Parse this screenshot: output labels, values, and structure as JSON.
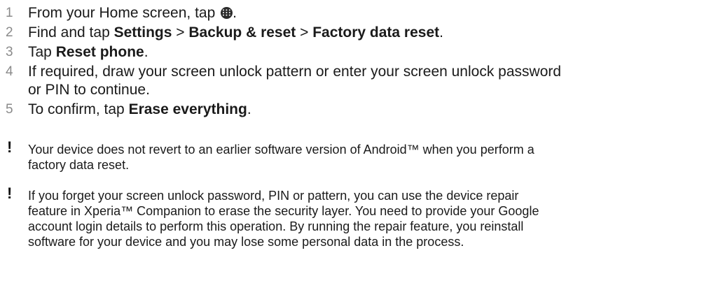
{
  "steps": [
    {
      "number": "1",
      "text_before": "From your Home screen, tap ",
      "icon": "apps-icon",
      "text_after": "."
    },
    {
      "number": "2",
      "text_before": "Find and tap ",
      "b1": "Settings",
      "sep1": " > ",
      "b2": "Backup & reset",
      "sep2": " > ",
      "b3": "Factory data reset",
      "text_after": "."
    },
    {
      "number": "3",
      "text_before": "Tap ",
      "b1": "Reset phone",
      "text_after": "."
    },
    {
      "number": "4",
      "line1": "If required, draw your screen unlock pattern or enter your screen unlock password",
      "line2": "or PIN to continue."
    },
    {
      "number": "5",
      "text_before": "To confirm, tap ",
      "b1": "Erase everything",
      "text_after": "."
    }
  ],
  "notes": [
    {
      "icon": "exclamation-icon",
      "symbol": "!",
      "line1": "Your device does not revert to an earlier software version of Android™ when you perform a",
      "line2": "factory data reset."
    },
    {
      "icon": "exclamation-icon",
      "symbol": "!",
      "line1": "If you forget your screen unlock password, PIN or pattern, you can use the device repair",
      "line2": "feature in Xperia™ Companion to erase the security layer. You need to provide your Google",
      "line3": "account login details to perform this operation. By running the repair feature, you reinstall",
      "line4": "software for your device and you may lose some personal data in the process."
    }
  ],
  "colors": {
    "text": "#1a1a1a",
    "step_number": "#8a8a8a",
    "background": "#ffffff"
  }
}
